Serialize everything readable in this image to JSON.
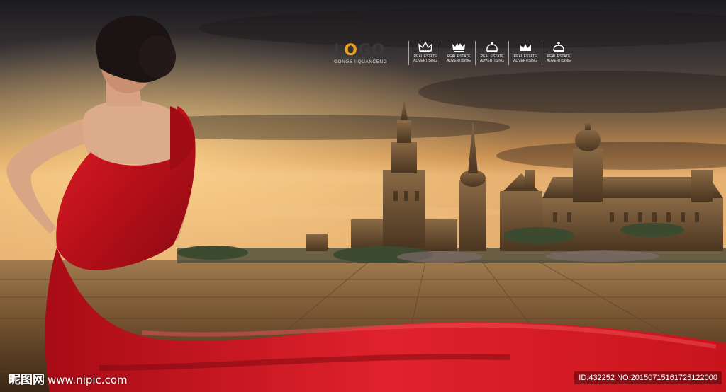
{
  "logo": {
    "word_start": "L",
    "word_o": "O",
    "word_end": "GO",
    "subtitle": "GONGS I QUANCENG"
  },
  "crowns": [
    {
      "icon": "crown-icon",
      "line1": "REAL ESTATE",
      "line2": "ADVERTISING"
    },
    {
      "icon": "crown-icon",
      "line1": "REAL ESTATE",
      "line2": "ADVERTISING"
    },
    {
      "icon": "crown-icon",
      "line1": "REAL ESTATE",
      "line2": "ADVERTISING"
    },
    {
      "icon": "crown-icon",
      "line1": "REAL ESTATE",
      "line2": "ADVERTISING"
    },
    {
      "icon": "crown-icon",
      "line1": "REAL ESTATE",
      "line2": "ADVERTISING"
    }
  ],
  "watermark": {
    "site_cn": "昵图网",
    "site_url": "www.nipic.com",
    "id_text": "ID:432252 NO:20150715161725122000"
  },
  "colors": {
    "dress": "#c8141c",
    "accent": "#e8a023",
    "sky_top": "#1e1c1e",
    "sky_glow": "#e0a05a"
  }
}
